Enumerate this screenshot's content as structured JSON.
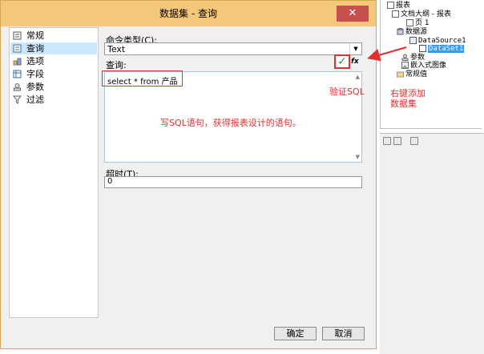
{
  "dialog": {
    "title": "数据集 - 查询",
    "close_label": "✕",
    "nav": [
      {
        "label": "常规",
        "icon": "general-icon"
      },
      {
        "label": "查询",
        "icon": "query-icon",
        "selected": true
      },
      {
        "label": "选项",
        "icon": "options-icon"
      },
      {
        "label": "字段",
        "icon": "fields-icon"
      },
      {
        "label": "参数",
        "icon": "parameters-icon"
      },
      {
        "label": "过滤",
        "icon": "filter-icon"
      }
    ],
    "command_type_label": "命令类型(C):",
    "command_type_value": "Text",
    "query_label": "查询:",
    "query_text": "select * from 产品",
    "timeout_label": "超时(T):",
    "timeout_value": "0",
    "ok_label": "确定",
    "cancel_label": "取消"
  },
  "annotations": {
    "verify_sql": "验证SQL",
    "write_sql": "写SQL语句，获得报表设计的语句。",
    "add_dataset_line1": "右键添加",
    "add_dataset_line2": "数据集"
  },
  "tree": {
    "items": [
      {
        "label": "报表"
      },
      {
        "label": "文档大纲 - 报表"
      },
      {
        "label": "页 1"
      },
      {
        "label": "数据源"
      },
      {
        "label": "DataSource1"
      },
      {
        "label": "DataSet1",
        "selected": true
      },
      {
        "label": "参数"
      },
      {
        "label": "嵌入式图像"
      },
      {
        "label": "常规值"
      }
    ]
  },
  "colors": {
    "titlebar": "#f5c77a",
    "close": "#c7504f",
    "annotation": "#e03030",
    "selection": "#cce8ff"
  }
}
